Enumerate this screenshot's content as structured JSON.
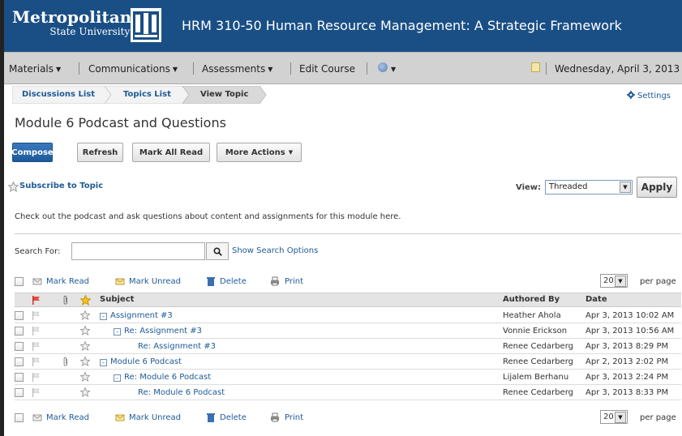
{
  "header": {
    "logo_main": "Metropolitan",
    "logo_sub": "State University",
    "course_title": "HRM 310-50 Human Resource Management: A Strategic Framework"
  },
  "menubar": {
    "items": [
      "Materials",
      "Communications",
      "Assessments",
      "Edit Course"
    ],
    "date": "Wednesday, April 3, 2013"
  },
  "breadcrumb": [
    "Discussions List",
    "Topics List",
    "View Topic"
  ],
  "settings_label": "Settings",
  "page_title": "Module 6 Podcast and Questions",
  "buttons": {
    "compose": "Compose",
    "refresh": "Refresh",
    "mark_all_read": "Mark All Read",
    "more_actions": "More Actions"
  },
  "subscribe_label": "Subscribe to Topic",
  "view": {
    "label": "View:",
    "value": "Threaded",
    "apply": "Apply"
  },
  "description": "Check out the podcast and ask questions about content and assignments for this module here.",
  "search": {
    "label": "Search For:",
    "value": "",
    "show_options": "Show Search Options"
  },
  "actions": {
    "mark_read": "Mark Read",
    "mark_unread": "Mark Unread",
    "delete": "Delete",
    "print": "Print",
    "per_page_value": "20",
    "per_page_label": "per page"
  },
  "table": {
    "columns": {
      "subject": "Subject",
      "authored_by": "Authored By",
      "date": "Date"
    },
    "rows": [
      {
        "subject": "Assignment #3",
        "level": 0,
        "toggle": "-",
        "attachment": false,
        "author": "Heather Ahola",
        "date": "Apr 3, 2013 10:02 AM"
      },
      {
        "subject": "Re: Assignment #3",
        "level": 1,
        "toggle": "-",
        "attachment": false,
        "author": "Vonnie Erickson",
        "date": "Apr 3, 2013 10:56 AM"
      },
      {
        "subject": "Re: Assignment #3",
        "level": 2,
        "toggle": "",
        "attachment": false,
        "author": "Renee Cedarberg",
        "date": "Apr 3, 2013 8:29 PM"
      },
      {
        "subject": "Module 6 Podcast",
        "level": 0,
        "toggle": "-",
        "attachment": true,
        "author": "Renee Cedarberg",
        "date": "Apr 2, 2013 2:02 PM"
      },
      {
        "subject": "Re: Module 6 Podcast",
        "level": 1,
        "toggle": "-",
        "attachment": false,
        "author": "Lijalem Berhanu",
        "date": "Apr 3, 2013 2:24 PM"
      },
      {
        "subject": "Re: Module 6 Podcast",
        "level": 2,
        "toggle": "",
        "attachment": false,
        "author": "Renee Cedarberg",
        "date": "Apr 3, 2013 8:33 PM"
      }
    ]
  },
  "colors": {
    "brand": "#1a4f86",
    "link": "#1f5a96"
  }
}
